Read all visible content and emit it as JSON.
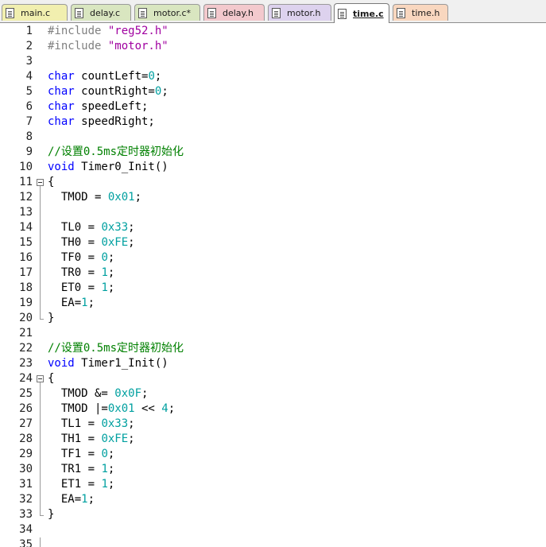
{
  "tabs": [
    {
      "label": "main.c",
      "color": "#f1efaf",
      "active": false
    },
    {
      "label": "delay.c",
      "color": "#d9e6c0",
      "active": false
    },
    {
      "label": "motor.c*",
      "color": "#d9e6c0",
      "active": false
    },
    {
      "label": "delay.h",
      "color": "#f3c9cd",
      "active": false
    },
    {
      "label": "motor.h",
      "color": "#ddd2ee",
      "active": false
    },
    {
      "label": "time.c",
      "color": "#ffffff",
      "active": true
    },
    {
      "label": "time.h",
      "color": "#f9d7bf",
      "active": false
    }
  ],
  "code_lines": [
    {
      "n": "1",
      "tokens": [
        {
          "t": "#include ",
          "k": "directive"
        },
        {
          "t": "\"reg52.h\"",
          "k": "string"
        }
      ]
    },
    {
      "n": "2",
      "tokens": [
        {
          "t": "#include ",
          "k": "directive"
        },
        {
          "t": "\"motor.h\"",
          "k": "string"
        }
      ]
    },
    {
      "n": "3",
      "tokens": []
    },
    {
      "n": "4",
      "tokens": [
        {
          "t": "char",
          "k": "keyword"
        },
        {
          "t": " countLeft=",
          "k": "plain"
        },
        {
          "t": "0",
          "k": "number"
        },
        {
          "t": ";",
          "k": "plain"
        }
      ]
    },
    {
      "n": "5",
      "tokens": [
        {
          "t": "char",
          "k": "keyword"
        },
        {
          "t": " countRight=",
          "k": "plain"
        },
        {
          "t": "0",
          "k": "number"
        },
        {
          "t": ";",
          "k": "plain"
        }
      ]
    },
    {
      "n": "6",
      "tokens": [
        {
          "t": "char",
          "k": "keyword"
        },
        {
          "t": " speedLeft;",
          "k": "plain"
        }
      ]
    },
    {
      "n": "7",
      "tokens": [
        {
          "t": "char",
          "k": "keyword"
        },
        {
          "t": " speedRight;",
          "k": "plain"
        }
      ]
    },
    {
      "n": "8",
      "tokens": []
    },
    {
      "n": "9",
      "tokens": [
        {
          "t": "//设置0.5ms定时器初始化",
          "k": "comment"
        }
      ]
    },
    {
      "n": "10",
      "tokens": [
        {
          "t": "void",
          "k": "keyword"
        },
        {
          "t": " Timer0_Init()",
          "k": "plain"
        }
      ]
    },
    {
      "n": "11",
      "tokens": [
        {
          "t": "{",
          "k": "plain"
        }
      ],
      "fold": "open"
    },
    {
      "n": "12",
      "tokens": [
        {
          "t": "  TMOD = ",
          "k": "plain"
        },
        {
          "t": "0x01",
          "k": "number"
        },
        {
          "t": ";",
          "k": "plain"
        }
      ]
    },
    {
      "n": "13",
      "tokens": []
    },
    {
      "n": "14",
      "tokens": [
        {
          "t": "  TL0 = ",
          "k": "plain"
        },
        {
          "t": "0x33",
          "k": "number"
        },
        {
          "t": ";",
          "k": "plain"
        }
      ]
    },
    {
      "n": "15",
      "tokens": [
        {
          "t": "  TH0 = ",
          "k": "plain"
        },
        {
          "t": "0xFE",
          "k": "number"
        },
        {
          "t": ";",
          "k": "plain"
        }
      ]
    },
    {
      "n": "16",
      "tokens": [
        {
          "t": "  TF0 = ",
          "k": "plain"
        },
        {
          "t": "0",
          "k": "number"
        },
        {
          "t": ";",
          "k": "plain"
        }
      ]
    },
    {
      "n": "17",
      "tokens": [
        {
          "t": "  TR0 = ",
          "k": "plain"
        },
        {
          "t": "1",
          "k": "number"
        },
        {
          "t": ";",
          "k": "plain"
        }
      ]
    },
    {
      "n": "18",
      "tokens": [
        {
          "t": "  ET0 = ",
          "k": "plain"
        },
        {
          "t": "1",
          "k": "number"
        },
        {
          "t": ";",
          "k": "plain"
        }
      ]
    },
    {
      "n": "19",
      "tokens": [
        {
          "t": "  EA=",
          "k": "plain"
        },
        {
          "t": "1",
          "k": "number"
        },
        {
          "t": ";",
          "k": "plain"
        }
      ]
    },
    {
      "n": "20",
      "tokens": [
        {
          "t": "}",
          "k": "plain"
        }
      ],
      "fold": "end"
    },
    {
      "n": "21",
      "tokens": []
    },
    {
      "n": "22",
      "tokens": [
        {
          "t": "//设置0.5ms定时器初始化",
          "k": "comment"
        }
      ]
    },
    {
      "n": "23",
      "tokens": [
        {
          "t": "void",
          "k": "keyword"
        },
        {
          "t": " Timer1_Init()",
          "k": "plain"
        }
      ]
    },
    {
      "n": "24",
      "tokens": [
        {
          "t": "{",
          "k": "plain"
        }
      ],
      "fold": "open"
    },
    {
      "n": "25",
      "tokens": [
        {
          "t": "  TMOD &= ",
          "k": "plain"
        },
        {
          "t": "0x0F",
          "k": "number"
        },
        {
          "t": ";",
          "k": "plain"
        }
      ]
    },
    {
      "n": "26",
      "tokens": [
        {
          "t": "  TMOD |=",
          "k": "plain"
        },
        {
          "t": "0x01",
          "k": "number"
        },
        {
          "t": " << ",
          "k": "plain"
        },
        {
          "t": "4",
          "k": "number"
        },
        {
          "t": ";",
          "k": "plain"
        }
      ]
    },
    {
      "n": "27",
      "tokens": [
        {
          "t": "  TL1 = ",
          "k": "plain"
        },
        {
          "t": "0x33",
          "k": "number"
        },
        {
          "t": ";",
          "k": "plain"
        }
      ]
    },
    {
      "n": "28",
      "tokens": [
        {
          "t": "  TH1 = ",
          "k": "plain"
        },
        {
          "t": "0xFE",
          "k": "number"
        },
        {
          "t": ";",
          "k": "plain"
        }
      ]
    },
    {
      "n": "29",
      "tokens": [
        {
          "t": "  TF1 = ",
          "k": "plain"
        },
        {
          "t": "0",
          "k": "number"
        },
        {
          "t": ";",
          "k": "plain"
        }
      ]
    },
    {
      "n": "30",
      "tokens": [
        {
          "t": "  TR1 = ",
          "k": "plain"
        },
        {
          "t": "1",
          "k": "number"
        },
        {
          "t": ";",
          "k": "plain"
        }
      ]
    },
    {
      "n": "31",
      "tokens": [
        {
          "t": "  ET1 = ",
          "k": "plain"
        },
        {
          "t": "1",
          "k": "number"
        },
        {
          "t": ";",
          "k": "plain"
        }
      ]
    },
    {
      "n": "32",
      "tokens": [
        {
          "t": "  EA=",
          "k": "plain"
        },
        {
          "t": "1",
          "k": "number"
        },
        {
          "t": ";",
          "k": "plain"
        }
      ]
    },
    {
      "n": "33",
      "tokens": [
        {
          "t": "}",
          "k": "plain"
        }
      ],
      "fold": "end"
    },
    {
      "n": "34",
      "tokens": []
    },
    {
      "n": "35",
      "tokens": []
    }
  ]
}
